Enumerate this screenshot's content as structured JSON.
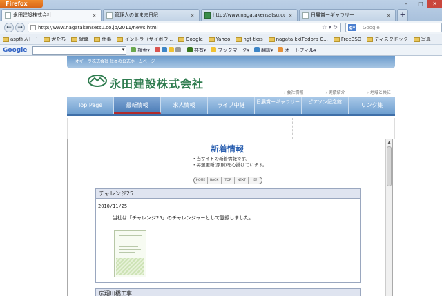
{
  "browser": {
    "app_button": "Firefox",
    "tabs": [
      {
        "title": "永田建設株式会社",
        "active": true
      },
      {
        "title": "管理人の気まま日記",
        "active": false
      },
      {
        "title": "http://www.nagatakensetsu.co.jp/",
        "active": false
      },
      {
        "title": "日展賞ーギャラリー",
        "active": false
      }
    ],
    "url": "http://www.nagatakensetsu.co.jp/2011/news.html",
    "search_placeholder": "Google"
  },
  "bookmarks": [
    "asp個人ＨＰ",
    "犬たち",
    "就職",
    "仕事",
    "イントラ（サイボウ...",
    "Google",
    "Yahoo",
    "ngt-tkss",
    "nagata kk(Fedora C...",
    "FreeBSD",
    "ディスクドック",
    "写真"
  ],
  "google_toolbar": {
    "logo": "Google",
    "items": [
      "検索",
      "共有",
      "ブックマーク",
      "翻訳",
      "オートフィル"
    ]
  },
  "site": {
    "top_strip": "オギーラ株式会社 社員の公式ホームページ",
    "company_name": "永田建設株式会社",
    "sublinks": [
      "会社情報",
      "実績紹介",
      "地域と共に"
    ],
    "menu": [
      {
        "label": "Top Page",
        "active": false
      },
      {
        "label": "最新情報",
        "active": true
      },
      {
        "label": "求人情報",
        "active": false
      },
      {
        "label": "ライブ中継",
        "active": false
      },
      {
        "label": "日展賞ーギャラリー",
        "active": false
      },
      {
        "label": "ピアソン記念館",
        "active": false
      },
      {
        "label": "リンク集",
        "active": false
      }
    ],
    "news": {
      "title": "新着情報",
      "note1": "・当サイトの新着情報です。",
      "note2": "・毎週更新(原則)を心掛けています。",
      "pager": [
        "HOME",
        "BACK",
        "TOP",
        "NEXT",
        "印"
      ],
      "articles": [
        {
          "title": "チャレンジ25",
          "date": "2010/11/25",
          "body": "当社は「チャレンジ25」のチャレンジャーとして登録しました。"
        },
        {
          "title": "広翔川橋工事"
        }
      ]
    }
  }
}
